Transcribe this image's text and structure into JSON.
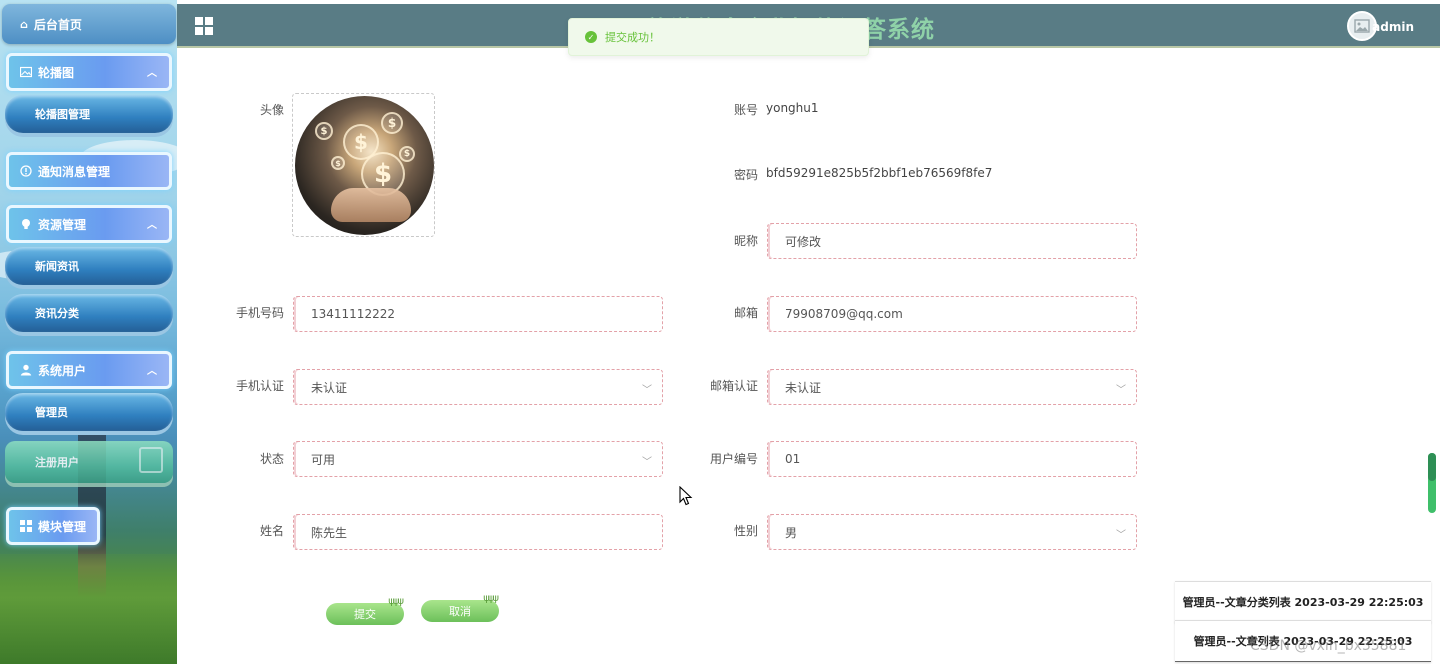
{
  "sidebar": {
    "home": "后台首页",
    "groups": [
      {
        "label": "轮播图",
        "icon": "image-icon",
        "children": [
          "轮播图管理"
        ]
      },
      {
        "label": "通知消息管理",
        "icon": "info-circle-icon",
        "children": []
      },
      {
        "label": "资源管理",
        "icon": "bulb-icon",
        "children": [
          "新闻资讯",
          "资讯分类"
        ]
      },
      {
        "label": "系统用户",
        "icon": "user-icon",
        "children": [
          "管理员",
          "注册用户"
        ]
      },
      {
        "label": "模块管理",
        "icon": "grid-icon",
        "children": []
      }
    ]
  },
  "header": {
    "title": "旅游信息企业智能问答系统",
    "username": "admin"
  },
  "toast": {
    "message": "提交成功！"
  },
  "form": {
    "avatar_label": "头像",
    "account": {
      "label": "账号",
      "value": "yonghu1"
    },
    "password": {
      "label": "密码",
      "value": "bfd59291e825b5f2bbf1eb76569f8fe7"
    },
    "nickname": {
      "label": "昵称",
      "value": "可修改"
    },
    "phone": {
      "label": "手机号码",
      "value": "13411112222"
    },
    "email": {
      "label": "邮箱",
      "value": "79908709@qq.com"
    },
    "phone_verify": {
      "label": "手机认证",
      "value": "未认证"
    },
    "email_verify": {
      "label": "邮箱认证",
      "value": "未认证"
    },
    "status": {
      "label": "状态",
      "value": "可用"
    },
    "user_no": {
      "label": "用户编号",
      "value": "01"
    },
    "name": {
      "label": "姓名",
      "value": "陈先生"
    },
    "gender": {
      "label": "性别",
      "value": "男"
    },
    "submit": "提交",
    "cancel": "取消"
  },
  "logs": [
    "管理员--文章分类列表 2023-03-29 22:25:03",
    "管理员--文章列表 2023-03-29 22:25:03"
  ],
  "watermark": "CSDN @vxin_bx35881",
  "colors": {
    "header_bg": "#597c85",
    "title": "#8fd2a8",
    "toast_bg": "#f0f9eb",
    "toast_text": "#67c23a",
    "button": "#6cc05a"
  }
}
